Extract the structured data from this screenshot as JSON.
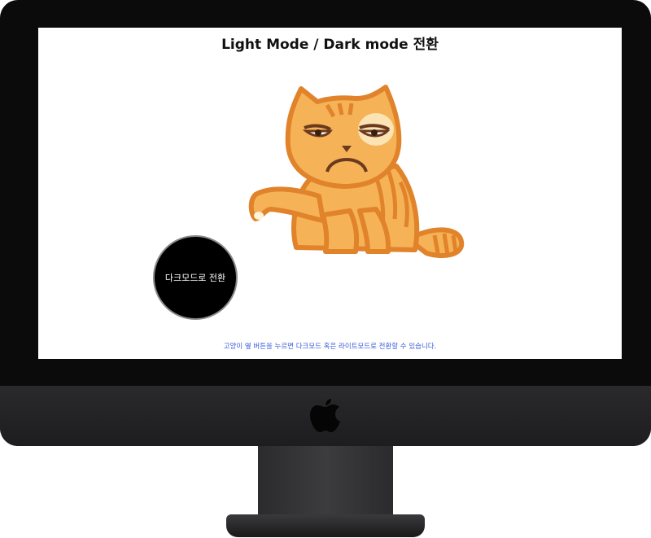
{
  "screen": {
    "title": "Light Mode / Dark mode 전환",
    "toggle_button_label": "다크모드로 전환",
    "caption": "고양이 옆 버튼을 누르면 다크모드 혹은 라이트모드로 전환할 수 있습니다.",
    "image": "grumpy-cat-illustration"
  },
  "colors": {
    "cat_fill": "#f6b257",
    "cat_outline": "#e0832a",
    "caption_text": "#3b5bd9",
    "button_bg": "#000000"
  },
  "icons": [
    "apple-logo-icon"
  ]
}
